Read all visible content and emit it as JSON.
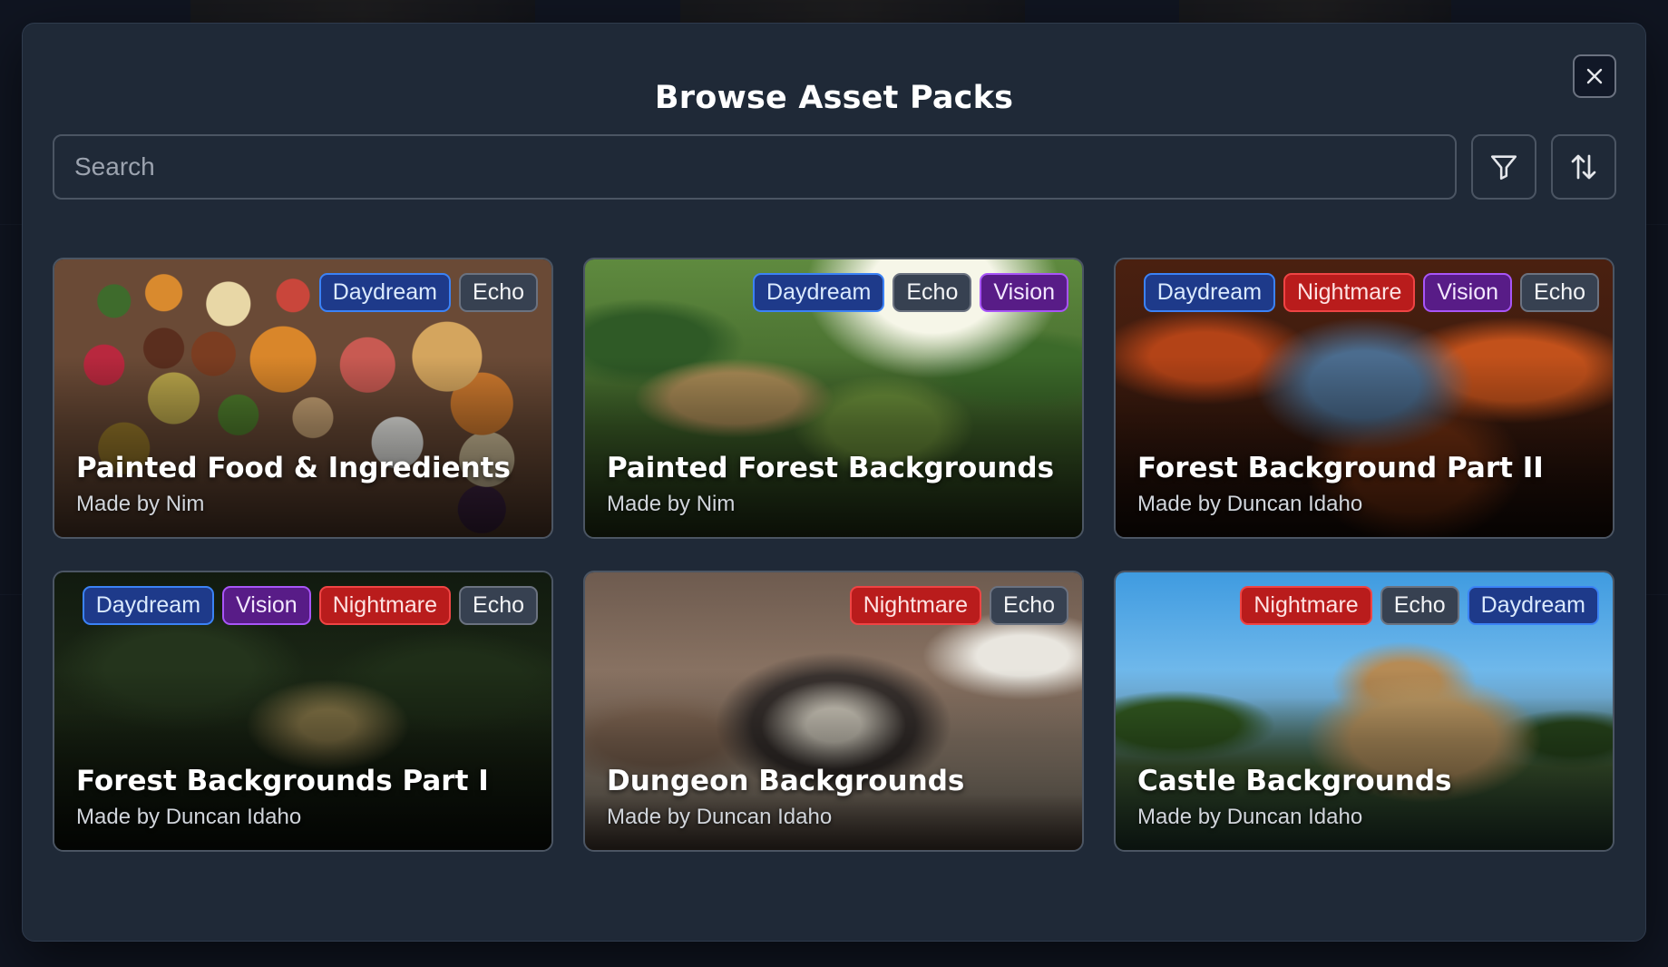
{
  "modal": {
    "title": "Browse Asset Packs",
    "search_placeholder": "Search"
  },
  "icons": {
    "close": "close-icon",
    "filter": "filter-icon",
    "sort": "sort-icon"
  },
  "colors": {
    "daydream": "#1e3a8a",
    "echo": "#374151",
    "vision": "#581c87",
    "nightmare": "#b91c1c"
  },
  "packs": [
    {
      "title": "Painted Food & Ingredients",
      "author": "Made by Nim",
      "tags": [
        "Daydream",
        "Echo"
      ]
    },
    {
      "title": "Painted Forest Backgrounds",
      "author": "Made by Nim",
      "tags": [
        "Daydream",
        "Echo",
        "Vision"
      ]
    },
    {
      "title": "Forest Background Part II",
      "author": "Made by Duncan Idaho",
      "tags": [
        "Daydream",
        "Nightmare",
        "Vision",
        "Echo"
      ]
    },
    {
      "title": "Forest Backgrounds Part I",
      "author": "Made by Duncan Idaho",
      "tags": [
        "Daydream",
        "Vision",
        "Nightmare",
        "Echo"
      ]
    },
    {
      "title": "Dungeon Backgrounds",
      "author": "Made by Duncan Idaho",
      "tags": [
        "Nightmare",
        "Echo"
      ]
    },
    {
      "title": "Castle Backgrounds",
      "author": "Made by Duncan Idaho",
      "tags": [
        "Nightmare",
        "Echo",
        "Daydream"
      ]
    }
  ]
}
